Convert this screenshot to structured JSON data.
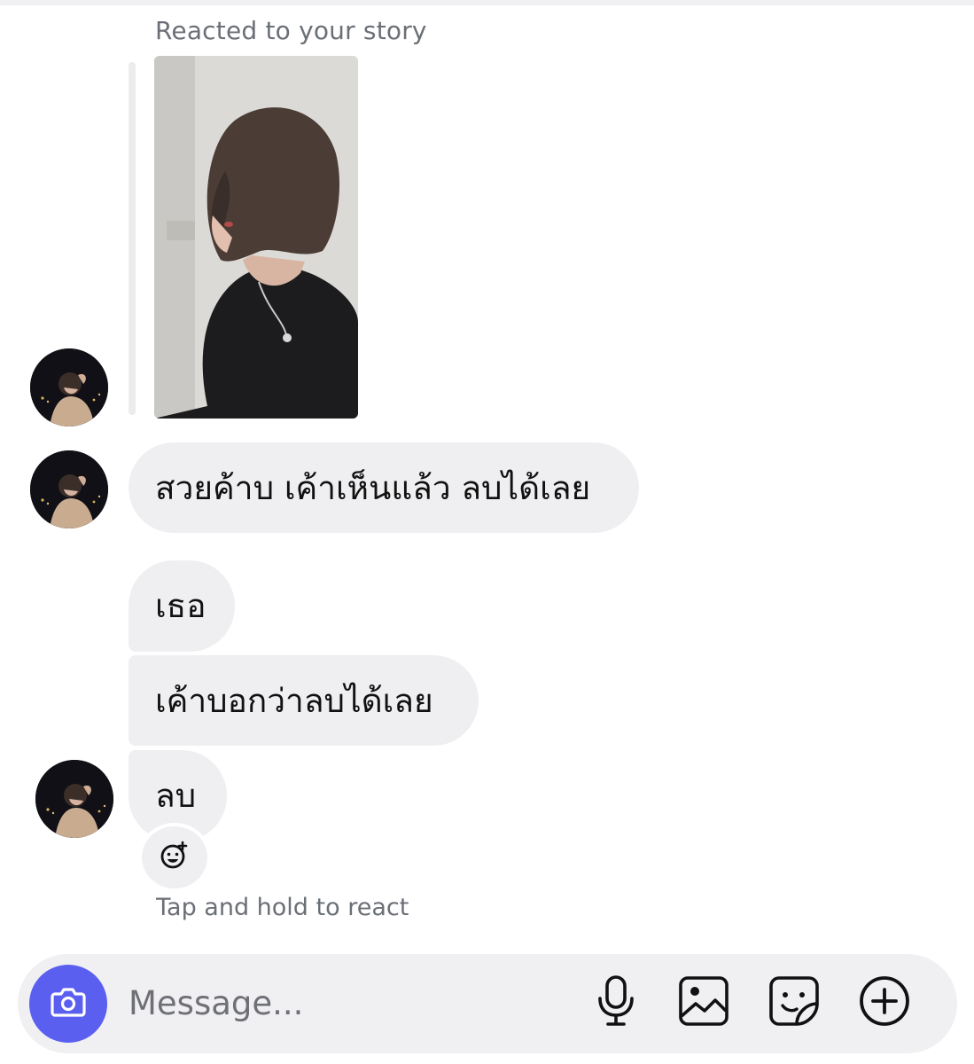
{
  "story": {
    "caption": "Reacted to your story"
  },
  "messages": [
    {
      "text": "สวยค้าบ เค้าเห็นแล้ว ลบได้เลย"
    },
    {
      "text": "เธอ"
    },
    {
      "text": "เค้าบอกว่าลบได้เลย"
    },
    {
      "text": "ลบ"
    }
  ],
  "reaction_hint": "Tap and hold to react",
  "composer": {
    "placeholder": "Message..."
  },
  "icons": {
    "camera": "camera-icon",
    "microphone": "microphone-icon",
    "gallery": "image-icon",
    "sticker": "sticker-icon",
    "more": "plus-circle-icon",
    "react": "emoji-add-icon"
  },
  "colors": {
    "accent": "#5b5ff0",
    "bubble": "#efeff1",
    "muted_text": "#6b6f76"
  }
}
